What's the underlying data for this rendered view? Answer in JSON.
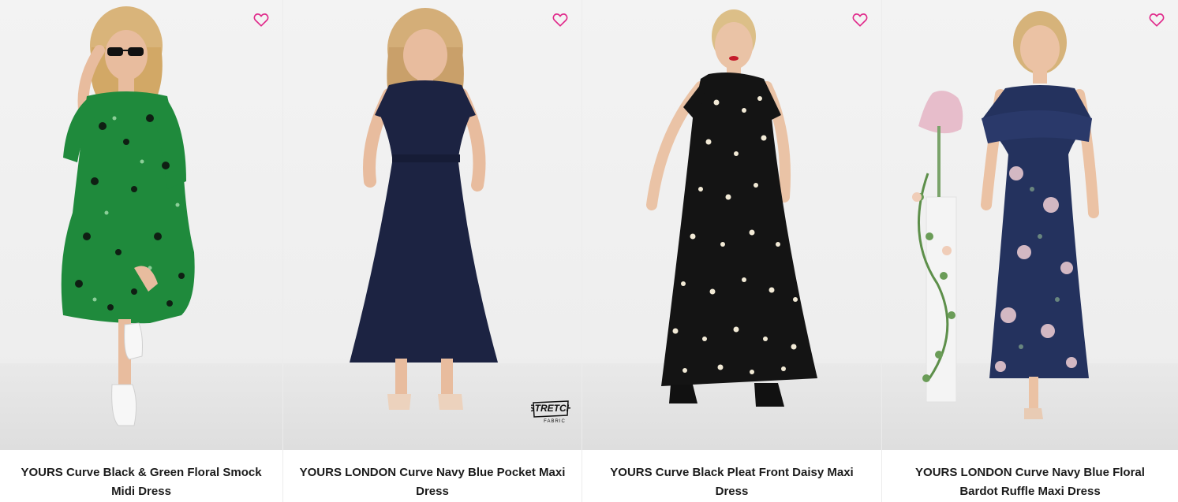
{
  "products": [
    {
      "title": "YOURS Curve Black & Green Floral Smock Midi Dress",
      "wishlist_icon": "heart-outline-icon",
      "dress_color": "#1f8a3c",
      "pattern_color": "#0d0d0d"
    },
    {
      "title": "YOURS LONDON Curve Navy Blue Pocket Maxi Dress",
      "wishlist_icon": "heart-outline-icon",
      "dress_color": "#1c2342",
      "badge": {
        "line1": "STRETCH",
        "line2": "FABRIC"
      }
    },
    {
      "title": "YOURS Curve Black Pleat Front Daisy Maxi Dress",
      "wishlist_icon": "heart-outline-icon",
      "dress_color": "#141414",
      "pattern_color": "#f2ead6"
    },
    {
      "title": "YOURS LONDON Curve Navy Blue Floral Bardot Ruffle Maxi Dress",
      "wishlist_icon": "heart-outline-icon",
      "dress_color": "#24325e",
      "pattern_color": "#e6c7cf"
    }
  ],
  "colors": {
    "wishlist_pink": "#e0288a",
    "title_text": "#1b1b1b",
    "skin": "#e8bc9e",
    "hair": "#d9b47a"
  }
}
